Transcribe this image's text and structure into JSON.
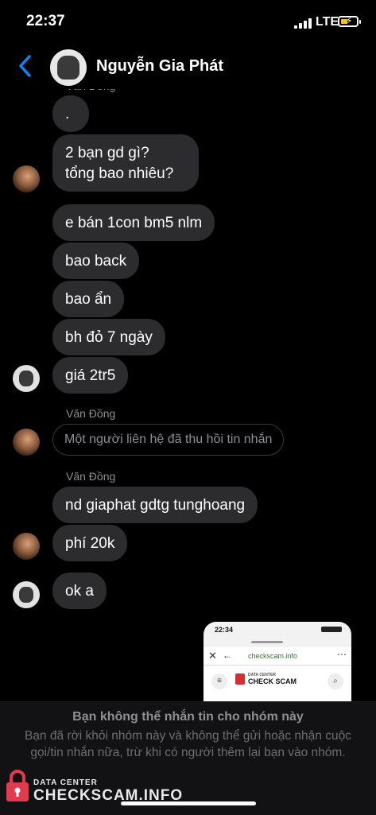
{
  "status_bar": {
    "time": "22:37",
    "network": "LTE"
  },
  "header": {
    "contact_name": "Nguyễn Gia Phát"
  },
  "messages": {
    "top_sender": "Văn Đồng",
    "m1": ".",
    "m2_line1": "2 bạn gd gì?",
    "m2_line2": "tổng bao nhiêu?",
    "m3": "e bán 1con bm5 nlm",
    "m4": "bao back",
    "m5": "bao ẩn",
    "m6": "bh đỏ 7 ngày",
    "m7": "giá 2tr5",
    "sender2": "Văn Đồng",
    "recalled": "Một người liên hệ đã thu hồi tin nhắn",
    "sender3": "Văn Đồng",
    "m8": "nd giaphat gdtg tunghoang",
    "m9": "phí 20k",
    "m10": "ok a"
  },
  "shared_image": {
    "time": "22:34",
    "url": "checkscam.info",
    "brand_small": "DATA CENTER",
    "brand": "CHECK SCAM"
  },
  "notice": {
    "title": "Bạn không thể nhắn tin cho nhóm này",
    "body": "Bạn đã rời khỏi nhóm này và không thể gửi hoặc nhận cuộc gọi/tin nhắn nữa, trừ khi có người thêm lại bạn vào nhóm."
  },
  "watermark": {
    "small": "DATA CENTER",
    "big": "CHECKSCAM.INFO"
  },
  "colors": {
    "accent": "#0a84ff",
    "bubble": "#2c2c2e",
    "watermark_lock": "#e53950"
  }
}
